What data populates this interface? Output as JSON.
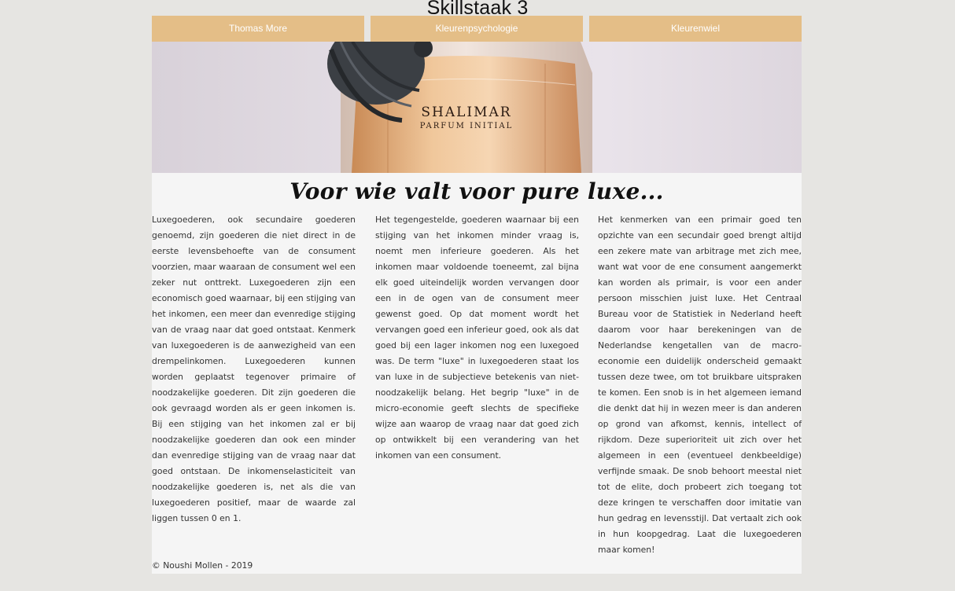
{
  "page": {
    "title": "Skillstaak 3"
  },
  "nav": {
    "items": [
      {
        "label": "Thomas More"
      },
      {
        "label": "Kleurenpsychologie"
      },
      {
        "label": "Kleurenwiel"
      }
    ],
    "background_color": "#e4be87",
    "text_color": "#ffffff"
  },
  "hero": {
    "bottle_label_line1": "SHALIMAR",
    "bottle_label_line2": "PARFUM INITIAL"
  },
  "main": {
    "tagline": "Voor wie valt voor pure luxe...",
    "columns": [
      {
        "text": "Luxegoederen, ook secundaire goederen genoemd, zijn goederen die niet direct in de eerste levensbehoefte van de consument voorzien, maar waaraan de consument wel een zeker nut onttrekt. Luxegoederen zijn een economisch goed waarnaar, bij een stijging van het inkomen, een meer dan evenredige stijging van de vraag naar dat goed ontstaat. Kenmerk van luxegoederen is de aanwezigheid van een drempelinkomen. Luxegoederen kunnen worden geplaatst tegenover primaire of noodzakelijke goederen. Dit zijn goederen die ook gevraagd worden als er geen inkomen is. Bij een stijging van het inkomen zal er bij noodzakelijke goederen dan ook een minder dan evenredige stijging van de vraag naar dat goed ontstaan. De inkomenselasticiteit van noodzakelijke goederen is, net als die van luxegoederen positief, maar de waarde zal liggen tussen 0 en 1."
      },
      {
        "text": "Het tegengestelde, goederen waarnaar bij een stijging van het inkomen minder vraag is, noemt men inferieure goederen. Als het inkomen maar voldoende toeneemt, zal bijna elk goed uiteindelijk worden vervangen door een in de ogen van de consument meer gewenst goed. Op dat moment wordt het vervangen goed een inferieur goed, ook als dat goed bij een lager inkomen nog een luxegoed was. De term \"luxe\" in luxegoederen staat los van luxe in de subjectieve betekenis van niet-noodzakelijk belang. Het begrip \"luxe\" in de micro-economie geeft slechts de specifieke wijze aan waarop de vraag naar dat goed zich op ontwikkelt bij een verandering van het inkomen van een consument."
      },
      {
        "text": "Het kenmerken van een primair goed ten opzichte van een secundair goed brengt altijd een zekere mate van arbitrage met zich mee, want wat voor de ene consument aangemerkt kan worden als primair, is voor een ander persoon misschien juist luxe. Het Centraal Bureau voor de Statistiek in Nederland heeft daarom voor haar berekeningen van de Nederlandse kengetallen van de macro-economie een duidelijk onderscheid gemaakt tussen deze twee, om tot bruikbare uitspraken te komen. Een snob is in het algemeen iemand die denkt dat hij in wezen meer is dan anderen op grond van afkomst, kennis, intellect of rijkdom. Deze superioriteit uit zich over het algemeen in een (eventueel denkbeeldige) verfijnde smaak. De snob behoort meestal niet tot de elite, doch probeert zich toegang tot deze kringen te verschaffen door imitatie van hun gedrag en levensstijl. Dat vertaalt zich ook in hun koopgedrag. Laat die luxegoederen maar komen!"
      }
    ]
  },
  "footer": {
    "text": "© Noushi Mollen - 2019"
  },
  "colors": {
    "page_background": "#e6e5e2",
    "content_background": "#f5f5f5"
  }
}
